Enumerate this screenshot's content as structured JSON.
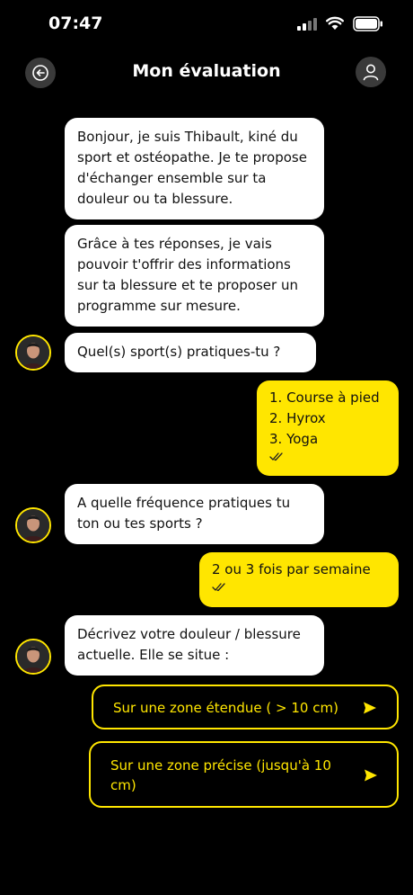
{
  "status": {
    "time": "07:47"
  },
  "header": {
    "title": "Mon évaluation",
    "back_icon": "back-arrow-icon",
    "profile_icon": "user-icon"
  },
  "messages": {
    "m1": "Bonjour, je suis Thibault, kiné du sport et ostéopathe. Je te propose d'échanger ensemble sur ta douleur ou ta blessure.",
    "m2": "Grâce à tes réponses, je vais pouvoir t'offrir des informations sur ta blessure et te proposer un programme sur mesure.",
    "m3": "Quel(s) sport(s) pratiques-tu ?",
    "u1": [
      "1. Course à pied",
      "2. Hyrox",
      "3. Yoga"
    ],
    "m4": "A quelle fréquence pratiques tu ton ou tes sports ?",
    "u2": "2 ou 3 fois par semaine",
    "m5": "Décrivez votre douleur / blessure actuelle. Elle se situe :"
  },
  "choices": {
    "c1": "Sur une zone étendue ( > 10 cm)",
    "c2": "Sur une zone précise (jusqu'à 10 cm)"
  },
  "colors": {
    "accent": "#ffe600",
    "background": "#000000",
    "bot_bubble": "#ffffff"
  }
}
